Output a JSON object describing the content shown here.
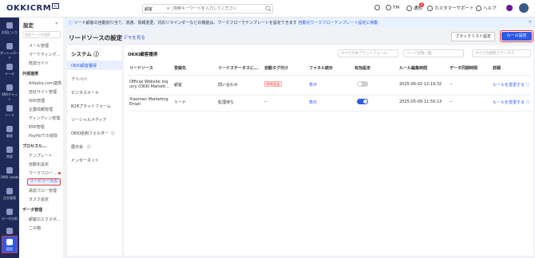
{
  "app": {
    "logo": "OKKICRM",
    "logo_ai": "AI"
  },
  "topbar": {
    "search_scope": "顧客",
    "search_placeholder": "検索キーワードを入力してください",
    "user_name": "TM",
    "notify_label": "通知",
    "notify_count": "4",
    "support_label": "カスタマーサポート",
    "help_label": "ヘルプ"
  },
  "rail": [
    {
      "label": "お気に入り"
    },
    {
      "label": "ダッシュボード"
    },
    {
      "label": "メール"
    },
    {
      "label": "SNSチャット"
    },
    {
      "label": "リード"
    },
    {
      "label": "顧客"
    },
    {
      "label": "商談"
    },
    {
      "label": "OKKI Leads"
    },
    {
      "label": "注文管理"
    },
    {
      "label": "データ分析"
    },
    {
      "label": "承認管理"
    },
    {
      "label": "設定"
    }
  ],
  "sidebar": {
    "title": "設定",
    "collapse": "«",
    "search_placeholder": "設定ページを検索",
    "items": [
      {
        "type": "item",
        "label": "メール管理"
      },
      {
        "type": "item",
        "label": "マーケティング..."
      },
      {
        "type": "item",
        "label": "既読ガイド"
      },
      {
        "type": "group",
        "label": "外部連携"
      },
      {
        "type": "item",
        "label": "Alibaba.com連携"
      },
      {
        "type": "item",
        "label": "自社サイト管理"
      },
      {
        "type": "item",
        "label": "SNS管理"
      },
      {
        "type": "item",
        "label": "企業情報管理"
      },
      {
        "type": "item",
        "label": "ディンディン管理"
      },
      {
        "type": "item",
        "label": "ERP管理"
      },
      {
        "type": "item",
        "label": "PayPalでの受取"
      },
      {
        "type": "group",
        "label": "プロセスル..."
      },
      {
        "type": "item",
        "label": "テンプレート"
      },
      {
        "type": "item",
        "label": "自動化設定"
      },
      {
        "type": "item",
        "label": "ワークフロー..."
      },
      {
        "type": "active",
        "label": "リードソースの..."
      },
      {
        "type": "item",
        "label": "承認フロー管理"
      },
      {
        "type": "item",
        "label": "タスク設定"
      },
      {
        "type": "group",
        "label": "データ管理"
      },
      {
        "type": "item",
        "label": "顧客のエクスポ..."
      },
      {
        "type": "item",
        "label": "ごみ箱"
      }
    ]
  },
  "notice": {
    "text": "リード顧客の自動割り当て、流通、情報変更、対応リマインダーなどの機能は、ワークフローでテンプレートを設定できます",
    "link": "自動化ワークフローテンプレート設定に移動",
    "close": "✕"
  },
  "header": {
    "title": "リードソースの設定",
    "demo_link": "デモを見る",
    "blacklist_button": "ブラックリスト設定",
    "rule_button": "ルール設定"
  },
  "system": {
    "title": "システム",
    "items": [
      "OKKI顧客獲得",
      "アリババ",
      "ビジネスメール",
      "B2Bプラットフォーム",
      "ソーシャルメディア",
      "OKKI名刺フォルダー",
      "展示会",
      "インターネット"
    ]
  },
  "main": {
    "title": "OKKI顧客獲得",
    "filters": [
      "すべての本プラットフォーム",
      "リード状態一覧",
      "すべての顧客ステータス"
    ]
  },
  "table": {
    "columns": [
      "リードソース",
      "登録先",
      "リードステータスに...",
      "自動タグ付け",
      "ファネル統計",
      "有効設定",
      "ルール編集時間",
      "データ同期時間",
      "詳細"
    ],
    "rows": [
      {
        "source_line1": "Official Website Inq",
        "source_line2": "uiry (OKKI Marketi...",
        "target": "顧客",
        "status": "問い合わせ",
        "tag": "OKKI広告",
        "funnel": "表示",
        "enabled": false,
        "edit_time": "2025-06-02 12:19:32",
        "sync_time": "--",
        "detail": "ルールを変更する"
      },
      {
        "source_line1": "Xiaoman Marketing",
        "source_line2": "Email",
        "target": "リード",
        "status": "処理待ち",
        "tag": "--",
        "funnel": "表示",
        "enabled": true,
        "edit_time": "2025-05-09 11:50:13",
        "sync_time": "--",
        "detail": "ルールを変更する"
      }
    ]
  },
  "colors": {
    "accent": "#2f5ae6",
    "rail": "#1f2a56",
    "highlight": "#e53935"
  }
}
